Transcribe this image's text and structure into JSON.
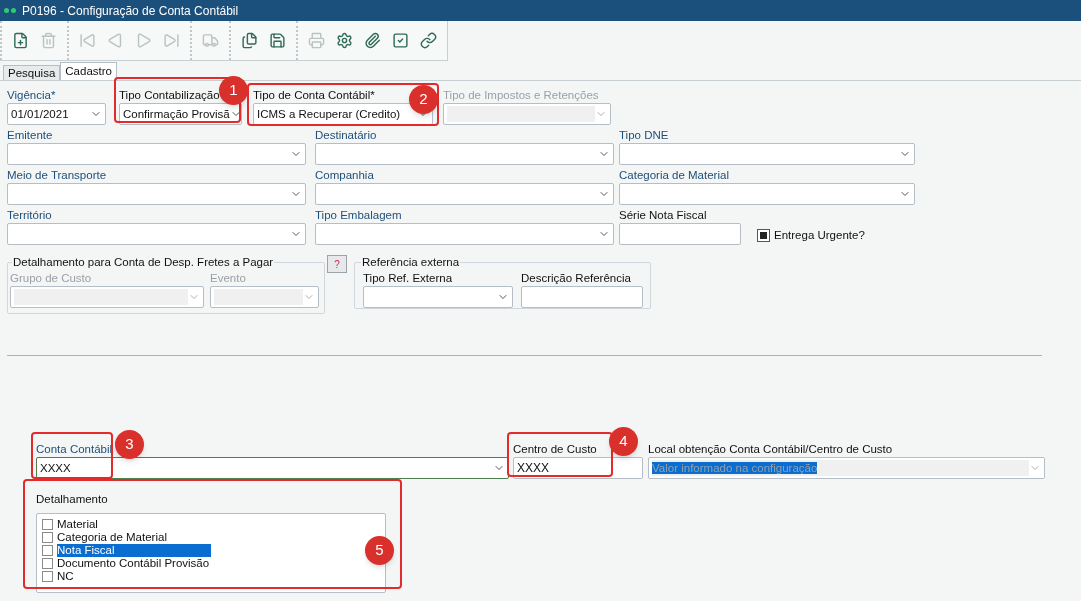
{
  "window": {
    "title": "P0196 - Configuração de Conta Contábil"
  },
  "toolbar": {
    "groups": [
      [
        {
          "kind": "new",
          "disabled": false
        },
        {
          "kind": "delete",
          "disabled": true
        }
      ],
      [
        {
          "kind": "first",
          "disabled": true
        },
        {
          "kind": "prev",
          "disabled": true
        },
        {
          "kind": "next",
          "disabled": true
        },
        {
          "kind": "last",
          "disabled": true
        }
      ],
      [
        {
          "kind": "truck-search",
          "disabled": true
        }
      ],
      [
        {
          "kind": "copy",
          "disabled": false
        },
        {
          "kind": "save",
          "disabled": false
        }
      ],
      [
        {
          "kind": "print",
          "disabled": true
        },
        {
          "kind": "settings",
          "disabled": false
        },
        {
          "kind": "attach",
          "disabled": false
        },
        {
          "kind": "check",
          "disabled": false
        },
        {
          "kind": "link",
          "disabled": false
        }
      ]
    ]
  },
  "tabs": [
    {
      "label": "Pesquisa",
      "selected": false
    },
    {
      "label": "Cadastro",
      "selected": true
    }
  ],
  "rows": [
    [
      {
        "label": "Vigência*",
        "kind": "combo",
        "value": "01/01/2021",
        "required": true,
        "disabled": false
      },
      {
        "label": "Tipo Contabilização",
        "kind": "combo",
        "value": "Confirmação Provisã",
        "required": false,
        "disabled": false
      },
      {
        "label": "Tipo de Conta Contábil*",
        "kind": "combo",
        "value": "ICMS a Recuperar (Credito)",
        "required": false,
        "disabled": false
      },
      {
        "label": "Tipo de Impostos e Retenções",
        "kind": "combo",
        "disabled": true
      }
    ],
    [
      {
        "label": "Emitente",
        "kind": "combo",
        "required": true,
        "disabled": false
      },
      {
        "label": "Destinatário",
        "kind": "combo",
        "required": true,
        "disabled": false
      },
      {
        "label": "Tipo DNE",
        "kind": "combo",
        "required": true,
        "disabled": false
      }
    ],
    [
      {
        "label": "Meio de Transporte",
        "kind": "combo",
        "required": true,
        "disabled": false
      },
      {
        "label": "Companhia",
        "kind": "combo",
        "required": true,
        "disabled": false
      },
      {
        "label": "Categoria de Material",
        "kind": "combo",
        "required": true,
        "disabled": false
      }
    ],
    [
      {
        "label": "Território",
        "kind": "combo",
        "required": true,
        "disabled": false
      },
      {
        "label": "Tipo Embalagem",
        "kind": "combo",
        "required": true,
        "disabled": false
      },
      {
        "label": "Série Nota Fiscal",
        "kind": "text",
        "required": false,
        "disabled": false
      },
      {
        "label": "Entrega Urgente?",
        "kind": "checkbox",
        "checked": true
      }
    ]
  ],
  "freight_group": {
    "title": "Detalhamento para Conta de Desp. Fretes a Pagar",
    "fields": [
      {
        "label": "Grupo de Custo",
        "kind": "combo",
        "disabled": true
      },
      {
        "label": "Evento",
        "kind": "combo",
        "disabled": true
      }
    ],
    "help_button": "?"
  },
  "external_group": {
    "title": "Referência externa",
    "fields": [
      {
        "label": "Tipo Ref. Externa",
        "kind": "combo",
        "required": false,
        "disabled": false
      },
      {
        "label": "Descrição Referência",
        "kind": "text",
        "required": false,
        "disabled": false
      }
    ]
  },
  "account_row": [
    {
      "label": "Conta Contábil",
      "kind": "combo",
      "value": "XXXX",
      "required": true,
      "disabled": false
    },
    {
      "label": "Centro de Custo",
      "kind": "text",
      "value": "XXXX",
      "required": false,
      "disabled": false
    },
    {
      "label": "Local obtenção Conta Contábil/Centro de Custo",
      "kind": "combo",
      "value": "Valor informado na configuração",
      "required": false,
      "readonly": true
    }
  ],
  "detail": {
    "label": "Detalhamento",
    "items": [
      {
        "label": "Material",
        "checked": false,
        "selected": false
      },
      {
        "label": "Categoria de Material",
        "checked": false,
        "selected": false
      },
      {
        "label": "Nota Fiscal",
        "checked": false,
        "selected": true
      },
      {
        "label": "Documento Contábil Provisão",
        "checked": false,
        "selected": false
      },
      {
        "label": "NC",
        "checked": false,
        "selected": false
      }
    ]
  },
  "annotations": [
    {
      "number": "1"
    },
    {
      "number": "2"
    },
    {
      "number": "3"
    },
    {
      "number": "4"
    },
    {
      "number": "5"
    }
  ]
}
